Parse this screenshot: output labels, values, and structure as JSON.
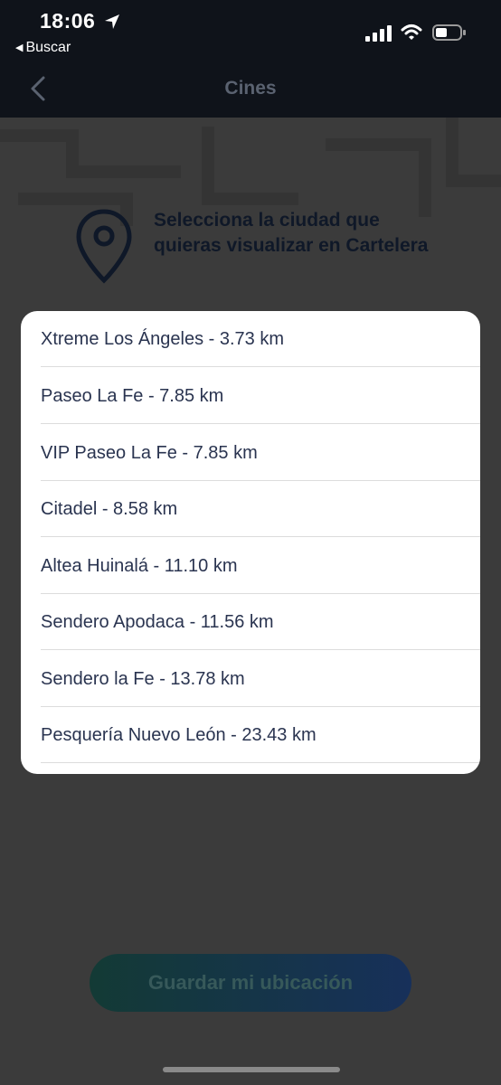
{
  "status_bar": {
    "time": "18:06",
    "back_app_label": "Buscar",
    "icons": [
      "location-arrow-icon",
      "signal-icon",
      "wifi-icon",
      "battery-icon"
    ]
  },
  "nav": {
    "title": "Cines",
    "back_icon": "chevron-left-icon"
  },
  "prompt": {
    "icon": "map-pin-icon",
    "text": "Selecciona la ciudad que quieras visualizar en Cartelera"
  },
  "cinemas": [
    {
      "label": "Xtreme Los Ángeles - 3.73 km"
    },
    {
      "label": "Paseo La Fe - 7.85 km"
    },
    {
      "label": "VIP Paseo La Fe - 7.85 km"
    },
    {
      "label": "Citadel - 8.58 km"
    },
    {
      "label": "Altea Huinalá - 11.10 km"
    },
    {
      "label": "Sendero Apodaca - 11.56 km"
    },
    {
      "label": "Sendero la Fe - 13.78 km"
    },
    {
      "label": "Pesquería Nuevo León - 23.43 km"
    }
  ],
  "save_button": {
    "label": "Guardar mi ubicación"
  },
  "colors": {
    "topbar": "#0f131a",
    "dim_background": "#3b3b3b",
    "option_text": "#2a3450",
    "button_gradient_start": "#133a35",
    "button_gradient_end": "#17305a"
  }
}
